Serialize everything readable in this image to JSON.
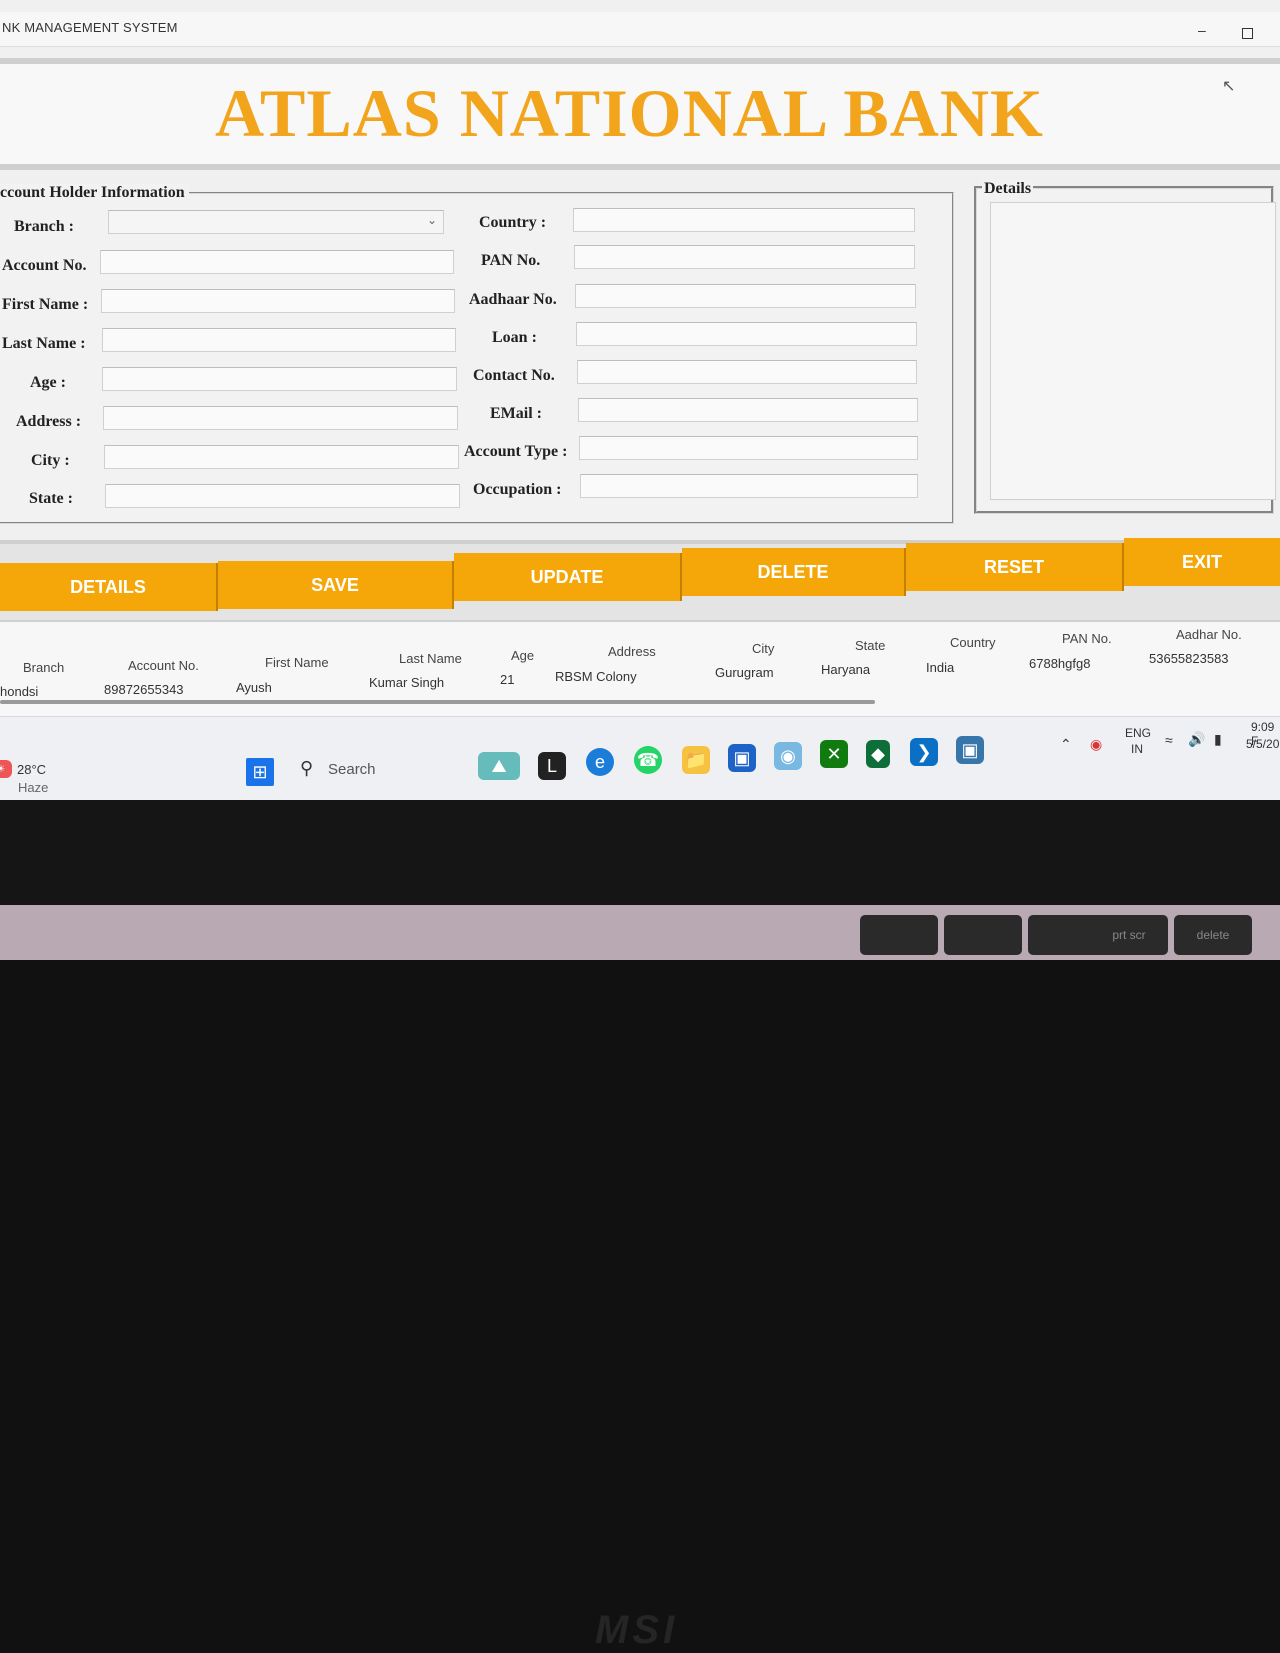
{
  "window": {
    "title": "NK MANAGEMENT SYSTEM",
    "minimize": "–"
  },
  "banner": {
    "title": "ATLAS NATIONAL BANK"
  },
  "account_holder": {
    "legend": "ccount Holder Information",
    "left_fields": [
      {
        "label": "Branch :",
        "value": "",
        "type": "combo"
      },
      {
        "label": "Account No.",
        "value": ""
      },
      {
        "label": "First Name :",
        "value": ""
      },
      {
        "label": "Last Name :",
        "value": ""
      },
      {
        "label": "Age :",
        "value": ""
      },
      {
        "label": "Address :",
        "value": ""
      },
      {
        "label": "City :",
        "value": ""
      },
      {
        "label": "State :",
        "value": ""
      }
    ],
    "right_fields": [
      {
        "label": "Country :",
        "value": ""
      },
      {
        "label": "PAN No.",
        "value": ""
      },
      {
        "label": "Aadhaar No.",
        "value": ""
      },
      {
        "label": "Loan :",
        "value": ""
      },
      {
        "label": "Contact No.",
        "value": ""
      },
      {
        "label": "EMail :",
        "value": ""
      },
      {
        "label": "Account Type :",
        "value": ""
      },
      {
        "label": "Occupation :",
        "value": ""
      }
    ]
  },
  "details": {
    "legend": "Details"
  },
  "buttons": [
    "DETAILS",
    "SAVE",
    "UPDATE",
    "DELETE",
    "RESET",
    "EXIT"
  ],
  "table": {
    "headers": [
      "Branch",
      "Account No.",
      "First Name",
      "Last Name",
      "Age",
      "Address",
      "City",
      "State",
      "Country",
      "PAN No.",
      "Aadhar No."
    ],
    "rows": [
      [
        "hondsi",
        "89872655343",
        "Ayush",
        "Kumar Singh",
        "21",
        "RBSM Colony",
        "Gurugram",
        "Haryana",
        "India",
        "6788hgfg8",
        "53655823583"
      ]
    ]
  },
  "taskbar": {
    "weather_temp": "28°C",
    "weather_desc": "Haze",
    "search_label": "Search",
    "lang": "ENG",
    "region": "IN",
    "time": "9:09 F",
    "date": "5/5/20"
  },
  "laptop": {
    "keys": [
      "prt scr",
      "delete"
    ]
  },
  "colors": {
    "accent": "#f5a70a",
    "title": "#f2a41c"
  }
}
